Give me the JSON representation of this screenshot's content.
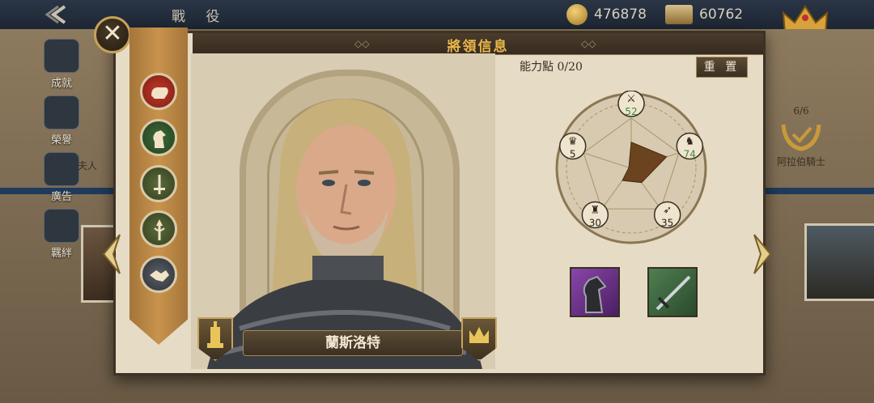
{
  "topbar": {
    "title": "戰 役",
    "gold": "476878",
    "scrolls": "60762"
  },
  "side_menu": [
    {
      "label": "成就",
      "icon": "trophy-icon"
    },
    {
      "label": "榮譽",
      "icon": "sword-shield-icon"
    },
    {
      "label": "廣告",
      "icon": "film-icon"
    },
    {
      "label": "羈絆",
      "icon": "handshake-icon"
    }
  ],
  "background": {
    "left_fragment": "夫人",
    "right_card_count": "6/6",
    "right_card_name": "阿拉伯騎士"
  },
  "dialog": {
    "title": "將領信息",
    "points": "能力點 0/20",
    "reset_label": "重 置",
    "general_name": "蘭斯洛特",
    "categories": [
      {
        "name": "fist-icon",
        "active": true
      },
      {
        "name": "knight-horse-icon",
        "active": false
      },
      {
        "name": "sword-icon",
        "active": false
      },
      {
        "name": "spear-icon",
        "active": false
      },
      {
        "name": "handshake-icon",
        "active": false
      }
    ],
    "stats": [
      {
        "name": "attack",
        "icon": "crossed-swords-icon",
        "value": 52
      },
      {
        "name": "cavalry",
        "icon": "horse-head-icon",
        "value": 74
      },
      {
        "name": "archery",
        "icon": "bow-icon",
        "value": 35
      },
      {
        "name": "defense",
        "icon": "castle-icon",
        "value": 30
      },
      {
        "name": "leadership",
        "icon": "crown-icon",
        "value": 5
      }
    ],
    "skills": [
      {
        "name": "horse-skill-icon",
        "color": "#7a3a9a"
      },
      {
        "name": "sword-skill-icon",
        "color": "#3d6a3f"
      }
    ]
  },
  "colors": {
    "accent": "#e9b64a",
    "radar_fill": "#6b431e",
    "highlight_value": "#3b8a3b"
  }
}
